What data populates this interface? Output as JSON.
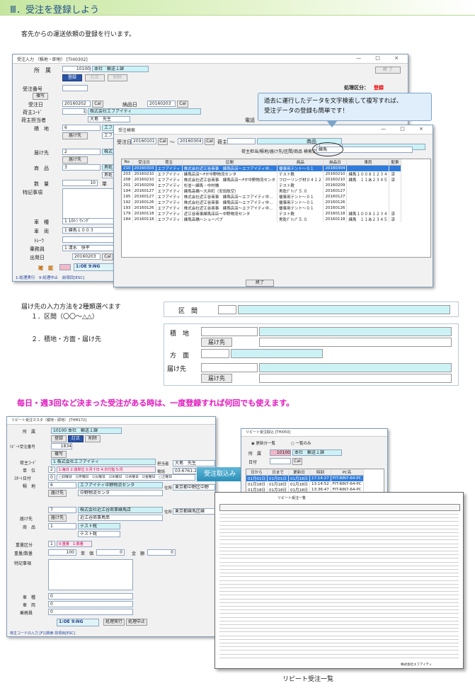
{
  "heading": "Ⅲ．受注を登録しよう",
  "intro": "客先からの運送依頼の登録を行います。",
  "order_window": {
    "title": "受注入力 （積地・即地） [THI0302]",
    "controls": "— □ ×",
    "shozoku_label": "所　属",
    "shozoku_code": "10100",
    "shozoku_name": "本社　輸送１課",
    "btn_touroku": "登録",
    "btn_b": "訂正",
    "btn_c": "削除",
    "btn_end": "終 了",
    "status_label": "処理区分：",
    "status_value": "登録",
    "order_no_label": "受注番号",
    "btn_copy": "複写",
    "order_date_label": "受注日",
    "order_date": "20160202",
    "btn_cal": "Cal",
    "delivery_date_label": "納品日",
    "delivery_date": "20160203",
    "shipper_code_label": "荷主ｺｰﾄﾞ",
    "shipper_code": "1",
    "shipper_name": "株式会社エフアイティ",
    "shipper_person_label": "荷主担当者",
    "shipper_person": "大島　先生",
    "phone_label": "電話",
    "load_label": "積　地",
    "load_code": "6",
    "load_name": "エフ",
    "dest_label": "届け先",
    "dest_code": "2",
    "dest_name": "株式",
    "btn_todoke": "届け先",
    "goods_label": "商　品",
    "goods_code": "3",
    "goods_name": "男乾",
    "goods_name2": "男乾",
    "qty_label": "数　量",
    "qty": "10",
    "unit_label": "単",
    "notes_label": "特記事項",
    "car_type_label": "車　種",
    "car_type": "1 10ﾄﾝ ｳｨﾝｸﾞ",
    "vehicle_label": "車　両",
    "vehicle": "1 練馬１００３",
    "trailer_label": "ﾄﾚｰﾗ",
    "crew_label": "乗務員",
    "crew": "1 清水　快平",
    "depart_label": "出発日",
    "depart_date": "20160203",
    "btn_zen": "確",
    "btn_kaku": "認",
    "mode_text": "1:OE 9:NG",
    "footer": "1:処理実行　9:処理中止　前項目[ESC]"
  },
  "callout": {
    "line1": "過去に運行したデータを文字検索して複写すれば、",
    "line2": "受注データの登録も簡単です！"
  },
  "search_window": {
    "title": "受注検索",
    "controls": "— □ ×",
    "order_date_label": "受注日",
    "from": "20160101",
    "btn_cal": "Cal",
    "tilde": "〜",
    "to": "20160304",
    "shipper_label": "荷主",
    "goods_label": "商品",
    "keyword_label": "荷主担当/積地/届け先/区間/商品 検索文字",
    "keyword": "練馬",
    "columns": [
      "No",
      "受注日",
      "荷主",
      "区間",
      "商品",
      "納品日",
      "車両",
      "配車"
    ],
    "rows": [
      [
        "210",
        "20160303",
        "エフアイティ",
        "株式会社近江谷商事　練馬店店～エフアイティ中…",
        "優事用テント～０１",
        "20160304",
        "",
        ""
      ],
      [
        "203",
        "20160210",
        "エフアイティ",
        "練馬店店～FIT中野物流センタ",
        "テスト靴",
        "20160210",
        "練馬１００８１２３４",
        "済"
      ],
      [
        "208",
        "20160210",
        "エフアイティ",
        "株式会社近江谷商事　練馬店店～FIT中野物流センタ",
        "フローリング材０４１２",
        "20160210",
        "練馬　１１あ２３４５",
        "済"
      ],
      [
        "201",
        "20160209",
        "エフアイティ",
        "杉並～練馬・中村橋",
        "テスト靴",
        "20160209",
        "",
        ""
      ],
      [
        "194",
        "20160127",
        "エフアイティ",
        "練馬高橋～大井町（安田航空）",
        "男乾ｸﾞﾘｯﾌﾟ５.０",
        "20160127",
        "",
        ""
      ],
      [
        "195",
        "20160127",
        "エフアイティ",
        "株式会社近江谷商事　練馬店店～エフアイティ中…",
        "優事用テント～０１",
        "20160127",
        "",
        ""
      ],
      [
        "192",
        "20160126",
        "エフアイティ",
        "株式会社近江谷商事　練馬店店～エフアイティ中…",
        "優事用テント～０１",
        "20160126",
        "",
        ""
      ],
      [
        "193",
        "20160126",
        "エフアイティ",
        "株式会社近江谷商事　練馬店店～エフアイティ中…",
        "優事用テント～０１",
        "20160126",
        "",
        ""
      ],
      [
        "179",
        "20160118",
        "エフアイティ",
        "近江谷商事練馬店店～中野物流センタ",
        "テスト靴",
        "20160118",
        "練馬１００８１２３４",
        "済"
      ],
      [
        "184",
        "20160118",
        "エフアイティ",
        "練馬高橋～シューパブ",
        "男乾ｸﾞﾘｯﾌﾟ５.０",
        "20160118",
        "練馬　１１あ２３４５",
        "済"
      ]
    ],
    "btn_end": "終了"
  },
  "methods": {
    "title": "届け先の入力方法を2種類選べます",
    "m1": "１．区間（〇〇〜△△）",
    "m2": "２．積地・方面・届け先",
    "kukan": "区　間",
    "tsumichi": "積　地",
    "houmen": "方　面",
    "todoke": "届け先",
    "btn_todoke": "届け先"
  },
  "repeat_heading": "毎日・週3回など決まった受注がある時は、一度登録すれば何回でも使えます。",
  "master_window": {
    "title": "リピート受注マスタ（積地・即地） [THM172]",
    "shozoku_label": "所　属",
    "shozoku": "10100 本社　輸送１課",
    "btn1": "登録",
    "btn2": "訂正",
    "btn3": "削除",
    "repeat_no_label": "ﾘﾋﾟｰﾄ受注番号",
    "repeat_no": "1834",
    "btn_copy": "複写",
    "shipper_label": "荷主ｺｰﾄﾞ",
    "shipper": "1 株式会社エフアイティ",
    "person_label": "担当者",
    "person": "大島　先生",
    "unit_label": "単　位",
    "unit": "2",
    "unit_text": "1:毎日 2:週単位 3:月十日 4:日付指 5:月",
    "phone_label": "電話",
    "phone": "03-6761-2701",
    "start_label": "ｽﾀｰﾄ日付",
    "start": "0",
    "weekdays": "□日曜日　☑月曜日　☑火曜日　☑水曜日　☑木曜日　☑金曜日　□土曜日",
    "load_label": "積　地",
    "load": "6",
    "load_name": "エフアイティ中野物流センタ",
    "load_name2": "中野物流センタ",
    "addr_label": "住所",
    "addr": "東京都中野区中野",
    "dest_label": "届け先",
    "dest": "7",
    "dest_name": "株式会社近江谷商事練馬店",
    "dest_name2": "近江谷商事鳥串",
    "addr2": "東京都練馬区練",
    "goods_label": "商　品",
    "goods": "1",
    "goods_name": "テスト靴",
    "goods_name2": "テスト靴",
    "weight_label": "重量区分",
    "weight": "1",
    "weight_text": "0:重量　1:数量",
    "qty_label": "重量/数量",
    "qty": "100",
    "price_label": "単　価",
    "price": "0",
    "amount_label": "金　額",
    "amount": "0",
    "notes_label": "特記事項",
    "car_label": "車　種",
    "car": "0",
    "vehicle_label": "車　両",
    "vehicle": "0",
    "crew_label": "乗務員",
    "crew": "0",
    "mode": "1:OE 9:NG",
    "btn_exec": "処理実行",
    "btn_stop": "処理中止",
    "footer": "荷主コードの入力 [F1]検索 前項目[ESC]"
  },
  "arrow_label": "受注取込み",
  "import_window": {
    "title": "リピート受注取込 [THI050]",
    "radio1": "◉ 更新分一覧",
    "radio2": "○ 一覧のみ",
    "shozoku_label": "所　属",
    "shozoku": "10100",
    "shozoku_name": "本社　輸送１課",
    "date_label": "日付",
    "btn_cal": "Cal",
    "columns": [
      "日から",
      "日まで",
      "更新日",
      "時刻",
      "PC名"
    ],
    "rows": [
      [
        "01月01日",
        "01月01日",
        "01月18日",
        "17:14:27",
        "FIT-RIN7-64-PC"
      ],
      [
        "01月18日",
        "01月18日",
        "01月18日",
        "13:14:52",
        "FIT-RIN7-64-PC"
      ],
      [
        "01月18日",
        "01月18日",
        "01月18日",
        "13:36:47",
        "FIT-RIN7-64-PC"
      ],
      [
        "01月07日",
        "01月07日",
        "01月07日",
        "14:21:29",
        "FIT-RIN7-64-PC"
      ],
      [
        "01月07日",
        "01月07日",
        "01月07日",
        "14:31:28",
        "FIT-RIN7-64-PC"
      ],
      [
        "01月07日",
        "01月07日",
        "01月07日",
        "14:35:46",
        "FIT-RIN7-64-PC"
      ],
      [
        "01月07日",
        "01月07日",
        "01月07日",
        "15:44:44",
        "FIT-RIN7-64-PC"
      ],
      [
        "01月07日",
        "01月07日",
        "01月07日",
        "17:24:56",
        "FIT-RIN7-64-PC"
      ]
    ]
  },
  "report": {
    "title": "リピート受注一覧",
    "company": "株式会社エフアイティ",
    "caption": "リピート受注一覧"
  }
}
